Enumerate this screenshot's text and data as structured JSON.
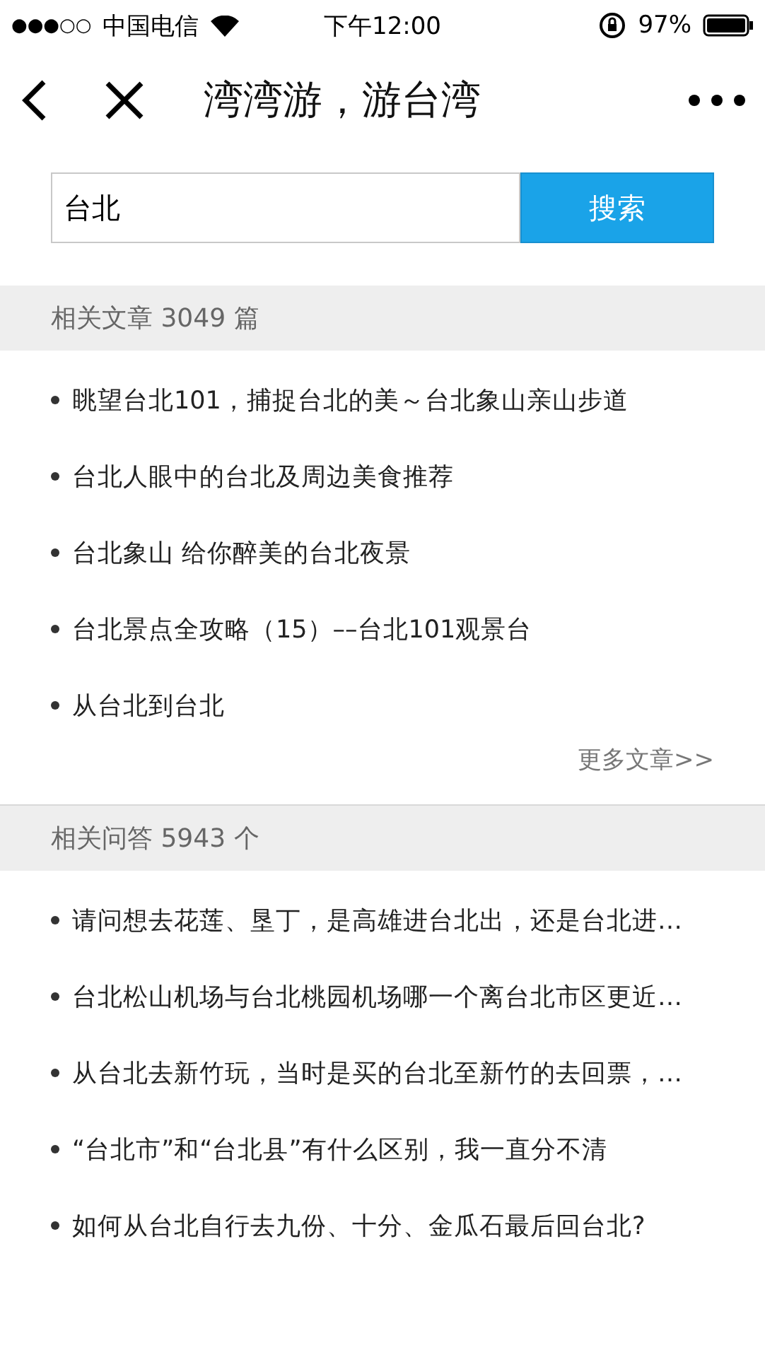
{
  "status_bar": {
    "signal": "●●●○○",
    "carrier": "中国电信",
    "time": "下午12:00",
    "battery": "97%"
  },
  "nav": {
    "title": "湾湾游，游台湾"
  },
  "search": {
    "value": "台北",
    "button": "搜索"
  },
  "sections": [
    {
      "header": "相关文章 3049 篇",
      "items": [
        "眺望台北101，捕捉台北的美～台北象山亲山步道",
        "台北人眼中的台北及周边美食推荐",
        "台北象山 给你醉美的台北夜景",
        "台北景点全攻略（15）––台北101观景台",
        "从台北到台北"
      ],
      "more": "更多文章>>"
    },
    {
      "header": "相关问答 5943 个",
      "items": [
        "请问想去花莲、垦丁，是高雄进台北出，还是台北进…",
        "台北松山机场与台北桃园机场哪一个离台北市区更近…",
        "从台北去新竹玩，当时是买的台北至新竹的去回票，…",
        "“台北市”和“台北县”有什么区别，我一直分不清",
        "如何从台北自行去九份、十分、金瓜石最后回台北?"
      ]
    }
  ]
}
